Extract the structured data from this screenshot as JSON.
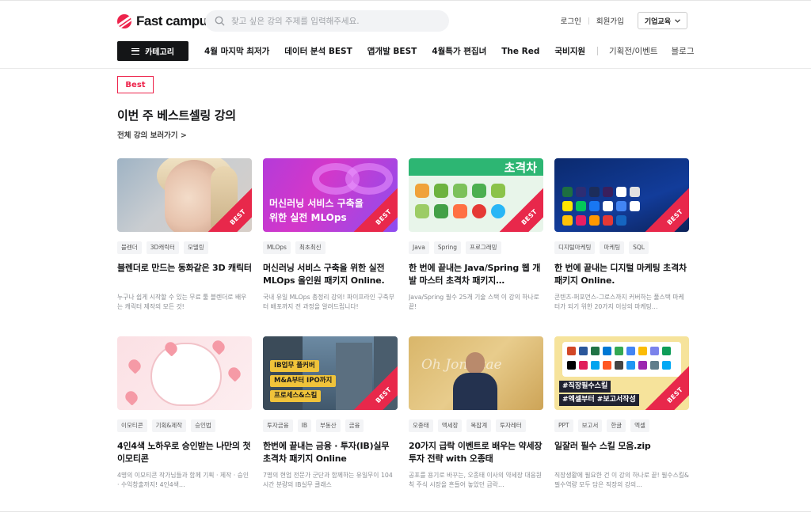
{
  "header": {
    "logo_text": "Fast campus",
    "search_placeholder": "찾고 싶은 강의 주제를 입력해주세요.",
    "login": "로그인",
    "signup": "회원가입",
    "corporate": "기업교육"
  },
  "nav": {
    "category_button": "카테고리",
    "items": [
      "4월 마지막 최저가",
      "데이터 분석 BEST",
      "앱개발 BEST",
      "4월특가 편집녀",
      "The Red",
      "국비지원"
    ],
    "secondary": [
      "기획전/이벤트",
      "블로그"
    ]
  },
  "section": {
    "badge": "Best",
    "title": "이번 주 베스트셀링 강의",
    "view_all": "전체 강의 보러가기 >"
  },
  "ribbon_label": "BEST",
  "cards": [
    {
      "tags": [
        "블렌더",
        "3D캐릭터",
        "모델링"
      ],
      "title": "블렌더로 만드는 동화같은 3D 캐릭터",
      "desc": "누구나 쉽게 시작할 수 있는 무료 툴 블렌더로 배우는 캐릭터 제작의 모든 것!",
      "best": true
    },
    {
      "tags": [
        "MLOps",
        "최초최신"
      ],
      "title": "머신러닝 서비스 구축을 위한 실전 MLOps 올인원 패키지 Online.",
      "desc": "국내 유일 MLOps 총정리 강의! 파이프라인 구축부터 배포까지 전 과정을 알려드립니다!",
      "thumb_text": "머신러닝 서비스 구축을 위한 실전 MLOps",
      "best": true
    },
    {
      "tags": [
        "Java",
        "Spring",
        "프로그래밍"
      ],
      "title": "한 번에 끝내는 Java/Spring 웹 개발 마스터 초격차 패키지…",
      "desc": "Java/Spring 필수 25개 기술 스택 이 강의 하나로 끝!",
      "thumb_text": "초격차",
      "best": true
    },
    {
      "tags": [
        "디지털마케팅",
        "마케팅",
        "SQL"
      ],
      "title": "한 번에 끝내는 디지털 마케팅 초격차 패키지 Online.",
      "desc": "콘텐츠-퍼포먼스-그로스까지 커버하는 풀스택 마케터가 되기 위한 20가지 이상의 마케팅…",
      "best": true
    },
    {
      "tags": [
        "이모티콘",
        "기획&제작",
        "승인법"
      ],
      "title": "4인4색 노하우로 승인받는 나만의 첫 이모티콘",
      "desc": "4명의 이모티콘 작가님들과 함께 기획 · 제작 · 승인 · 수익창출까지! 4인4색…",
      "best": false
    },
    {
      "tags": [
        "투자금융",
        "IB",
        "부동산",
        "금융"
      ],
      "title": "한번에 끝내는 금융 · 투자(IB)실무 초격차 패키지 Online",
      "desc": "7명의 현업 전문가 군단과 함께하는 유일무이 104시간 분량의 IB실무 클래스",
      "thumb_pills": [
        "IB업무 풀커버",
        "M&A부터 IPO까지",
        "프로세스&스킬"
      ],
      "best": true
    },
    {
      "tags": [
        "오종태",
        "액세장",
        "복잡계",
        "투자레터"
      ],
      "title": "20가지 급락 이벤트로 배우는 약세장 투자 전략 with 오종태",
      "desc": "공포를 용기로 바꾸는, 오종태 이사의 약세장 대응원칙 주식 시장을 흔들어 놓았던 급락…",
      "thumb_script": "Oh Jong tae",
      "best": false
    },
    {
      "tags": [
        "PPT",
        "보고서",
        "한글",
        "엑셀"
      ],
      "title": "일잘러 필수 스킬 모음.zip",
      "desc": "직장생활에 필요한 건 이 강의 하나로 끝! 필수스킬&필수역량 모두 담은 직장의 강의…",
      "thumb_banners": [
        "#직장필수스킬",
        "#엑셀부터 #보고서작성"
      ],
      "best": true
    }
  ],
  "colors": {
    "brand": "#ed234b",
    "dark": "#141517"
  }
}
